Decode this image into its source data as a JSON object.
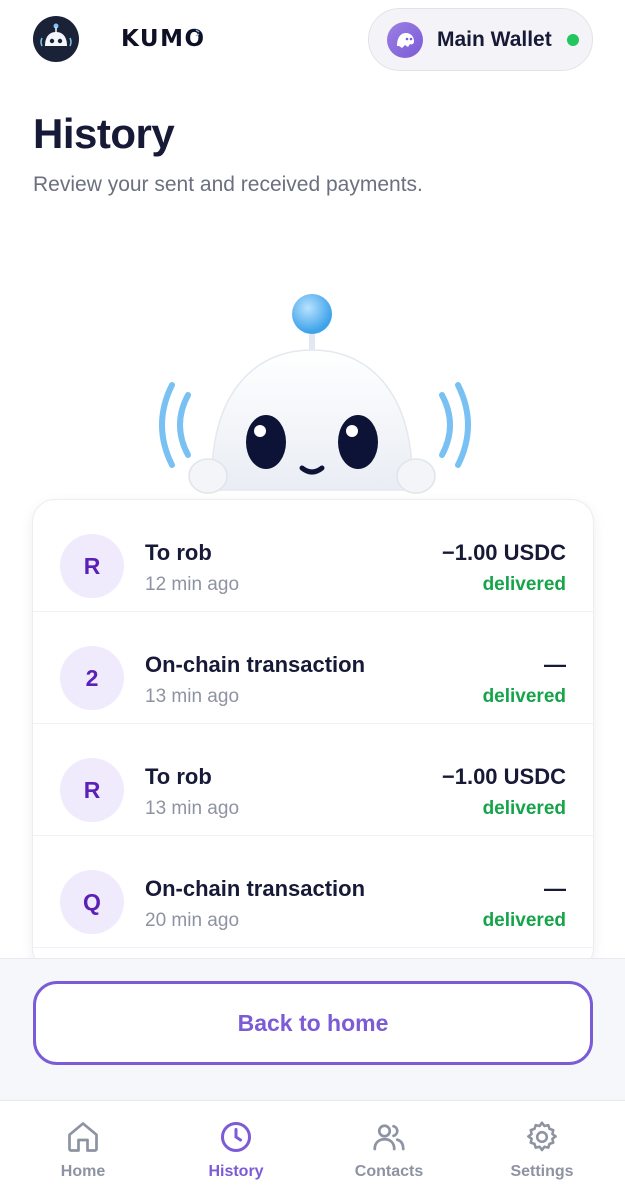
{
  "header": {
    "brand": "KUMO",
    "wallet_name": "Main Wallet",
    "wallet_status_color": "#22c55e"
  },
  "page": {
    "title": "History",
    "subtitle": "Review your sent and received payments."
  },
  "transactions": [
    {
      "initial": "R",
      "title": "To rob",
      "time": "12 min ago",
      "amount": "−1.00 USDC",
      "status": "delivered"
    },
    {
      "initial": "2",
      "title": "On-chain transaction",
      "time": "13 min ago",
      "amount": "—",
      "status": "delivered"
    },
    {
      "initial": "R",
      "title": "To rob",
      "time": "13 min ago",
      "amount": "−1.00 USDC",
      "status": "delivered"
    },
    {
      "initial": "Q",
      "title": "On-chain transaction",
      "time": "20 min ago",
      "amount": "—",
      "status": "delivered"
    }
  ],
  "actions": {
    "back_label": "Back to home"
  },
  "tabs": [
    {
      "label": "Home",
      "icon": "home-icon"
    },
    {
      "label": "History",
      "icon": "clock-icon",
      "active": true
    },
    {
      "label": "Contacts",
      "icon": "users-icon"
    },
    {
      "label": "Settings",
      "icon": "gear-icon"
    }
  ],
  "colors": {
    "accent": "#7b5bd6",
    "status_delivered": "#16a34a",
    "text_primary": "#171a36"
  }
}
